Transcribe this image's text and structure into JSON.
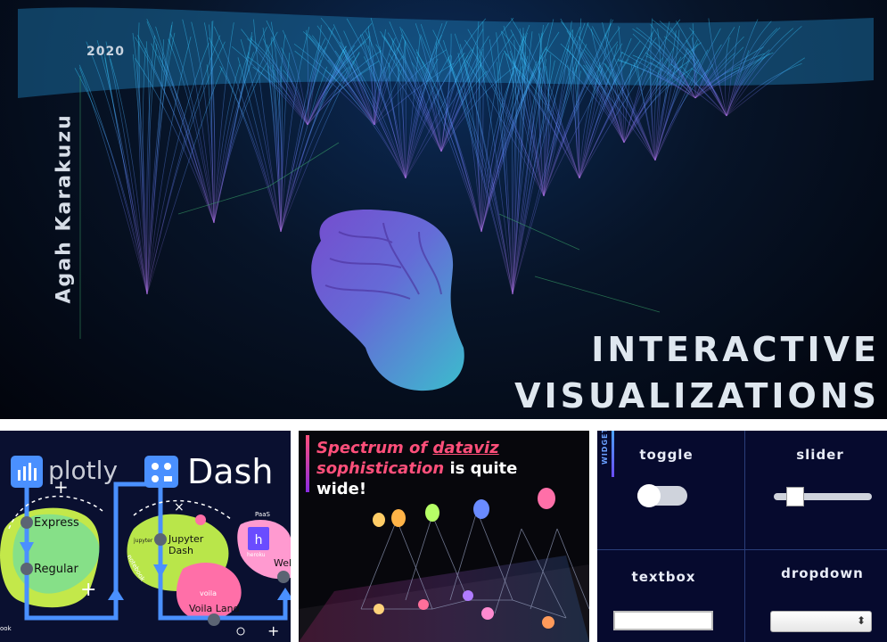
{
  "hero": {
    "year": "2020",
    "author": "Agah Karakuzu",
    "title_line1": "INTERACTIVE",
    "title_line2": "VISUALIZATIONS"
  },
  "dash_panel": {
    "plotly_label": "plotly",
    "dash_label": "Dash",
    "express_label": "Express",
    "regular_label": "Regular",
    "jupyter_dash_label": "Jupyter\nDash",
    "voila_land_label": "Voila Land",
    "voila_small": "voila",
    "heroku_label": "heroku",
    "web_label": "Web",
    "paas_label": "PaaS",
    "jupyter_small": "jupyter",
    "notebook_label": "notebook",
    "book_label": "ook"
  },
  "spectrum_panel": {
    "caption_pink": "Spectrum of ",
    "caption_underlined": "dataviz",
    "caption_pink2": "sophistication",
    "caption_white": " is quite",
    "caption_line3": "wide!"
  },
  "widgets_panel": {
    "side_label": "WIDGETS",
    "toggle_label": "toggle",
    "slider_label": "slider",
    "textbox_label": "textbox",
    "dropdown_label": "dropdown",
    "dropdown_caret": "⬍",
    "slider_value": 0.15
  }
}
